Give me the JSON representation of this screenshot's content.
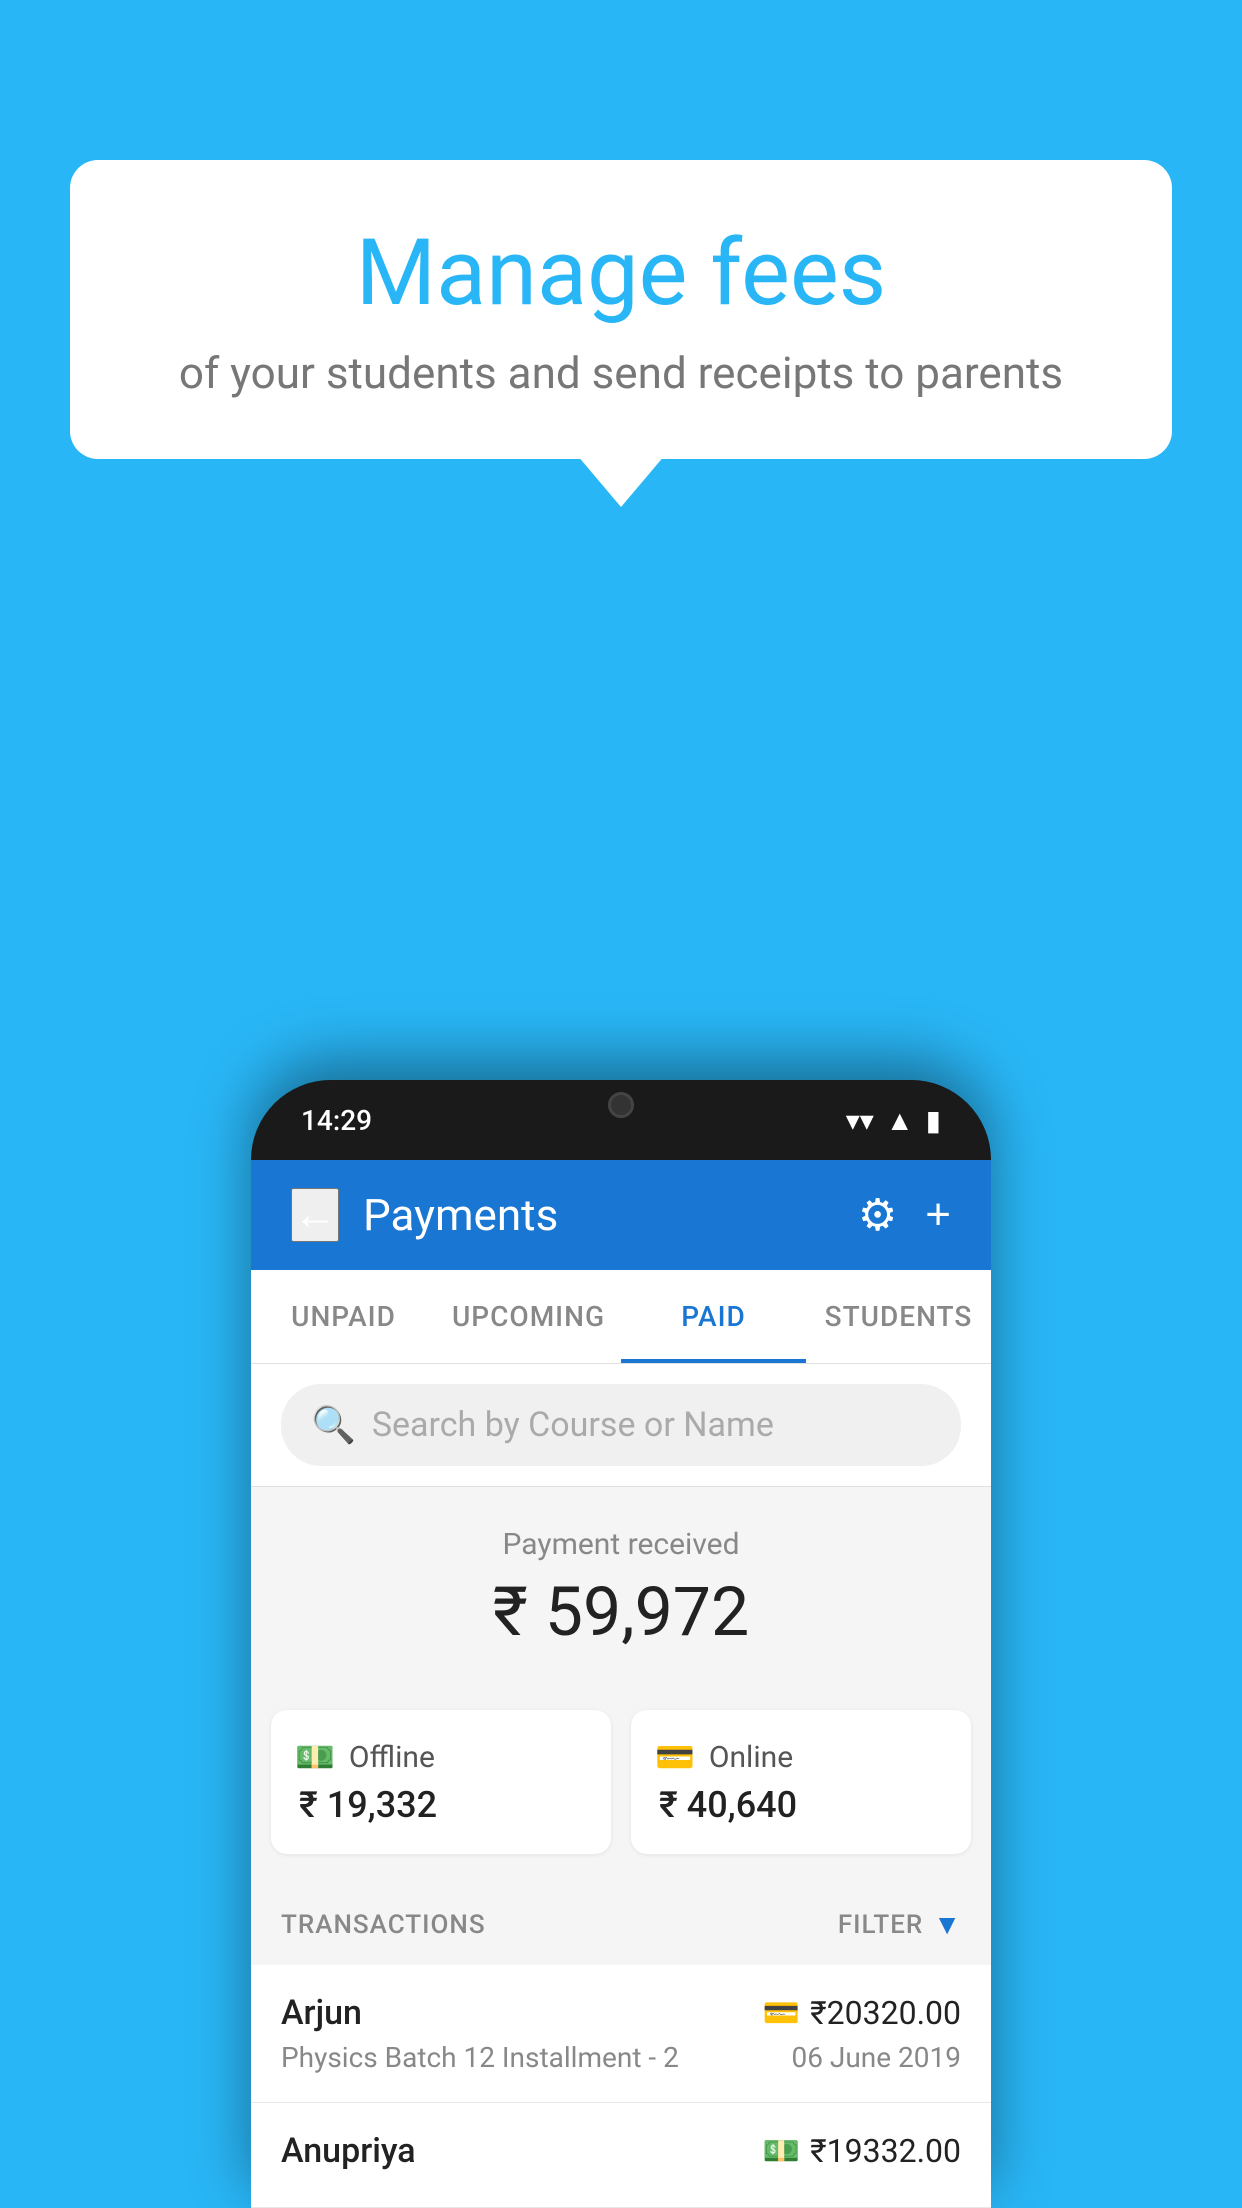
{
  "background_color": "#29B6F6",
  "speech_bubble": {
    "title": "Manage fees",
    "subtitle": "of your students and send receipts to parents"
  },
  "phone": {
    "status_bar": {
      "time": "14:29"
    },
    "header": {
      "back_label": "←",
      "title": "Payments",
      "gear_icon": "⚙",
      "plus_icon": "+"
    },
    "tabs": [
      {
        "label": "UNPAID",
        "active": false
      },
      {
        "label": "UPCOMING",
        "active": false
      },
      {
        "label": "PAID",
        "active": true
      },
      {
        "label": "STUDENTS",
        "active": false
      }
    ],
    "search": {
      "placeholder": "Search by Course or Name"
    },
    "payment_summary": {
      "label": "Payment received",
      "amount": "₹ 59,972",
      "offline_label": "Offline",
      "offline_amount": "₹ 19,332",
      "online_label": "Online",
      "online_amount": "₹ 40,640"
    },
    "transactions": {
      "section_label": "TRANSACTIONS",
      "filter_label": "FILTER",
      "items": [
        {
          "name": "Arjun",
          "amount": "₹20320.00",
          "detail": "Physics Batch 12 Installment - 2",
          "date": "06 June 2019",
          "icon_type": "card"
        },
        {
          "name": "Anupriya",
          "amount": "₹19332.00",
          "detail": "",
          "date": "",
          "icon_type": "cash"
        }
      ]
    }
  }
}
